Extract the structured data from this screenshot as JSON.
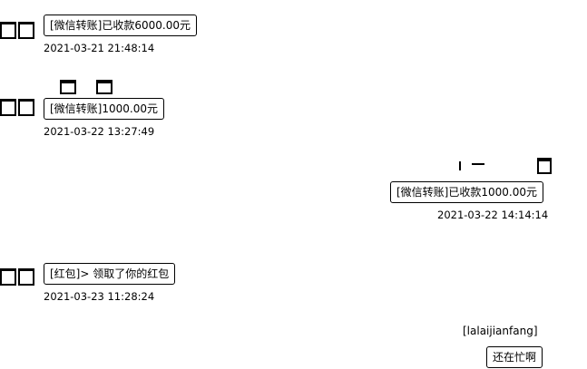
{
  "messages": [
    {
      "text": "[微信转账]已收款6000.00元",
      "time": "2021-03-21 21:48:14"
    },
    {
      "text": "[微信转账]1000.00元",
      "time": "2021-03-22 13:27:49"
    },
    {
      "text": "[微信转账]已收款1000.00元",
      "time": "2021-03-22 14:14:14"
    },
    {
      "text": "[红包]>  领取了你的红包",
      "time": "2021-03-23 11:28:24"
    },
    {
      "sender": "[lalaijianfang]",
      "text": "还在忙啊"
    }
  ]
}
